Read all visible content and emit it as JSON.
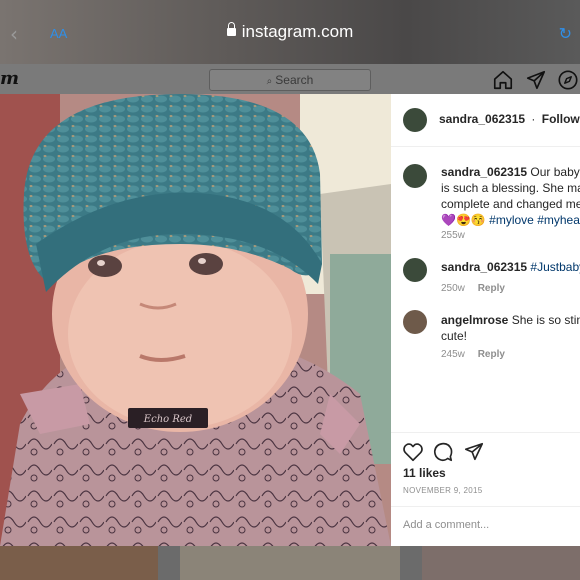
{
  "browser": {
    "back_glyph": "‹",
    "text_size_label": "AA",
    "url": "instagram.com",
    "reload_glyph": "↻"
  },
  "ig_header": {
    "logo_fragment": "m",
    "search_placeholder": "Search",
    "nav_icons": [
      "home-icon",
      "direct-icon",
      "explore-icon"
    ]
  },
  "post": {
    "image_alt_text": "Echo Red",
    "author": "sandra_062315",
    "following_label": "Following",
    "separator": "·",
    "caption": {
      "username": "sandra_062315",
      "text_line1": "Our babygi",
      "text_line2": "is such a blessing. She make",
      "text_line3": "complete and changed me a",
      "emoji": "💜😍😚",
      "hashtags": "#mylove #myheart",
      "age": "255w"
    },
    "comments": [
      {
        "username": "sandra_062315",
        "text": "#Justbaby",
        "age": "250w",
        "reply": "Reply"
      },
      {
        "username": "angelmrose",
        "text_line1": "She is so stinkin",
        "text_line2": "cute!",
        "age": "245w",
        "reply": "Reply"
      }
    ],
    "likes": "11 likes",
    "date": "NOVEMBER 9, 2015",
    "add_comment_placeholder": "Add a comment..."
  },
  "colors": {
    "link_blue": "#00376b",
    "safari_blue": "#2f8fe8",
    "muted_grey": "#8e8e8e",
    "dim_overlay": "#6b6b6b"
  }
}
